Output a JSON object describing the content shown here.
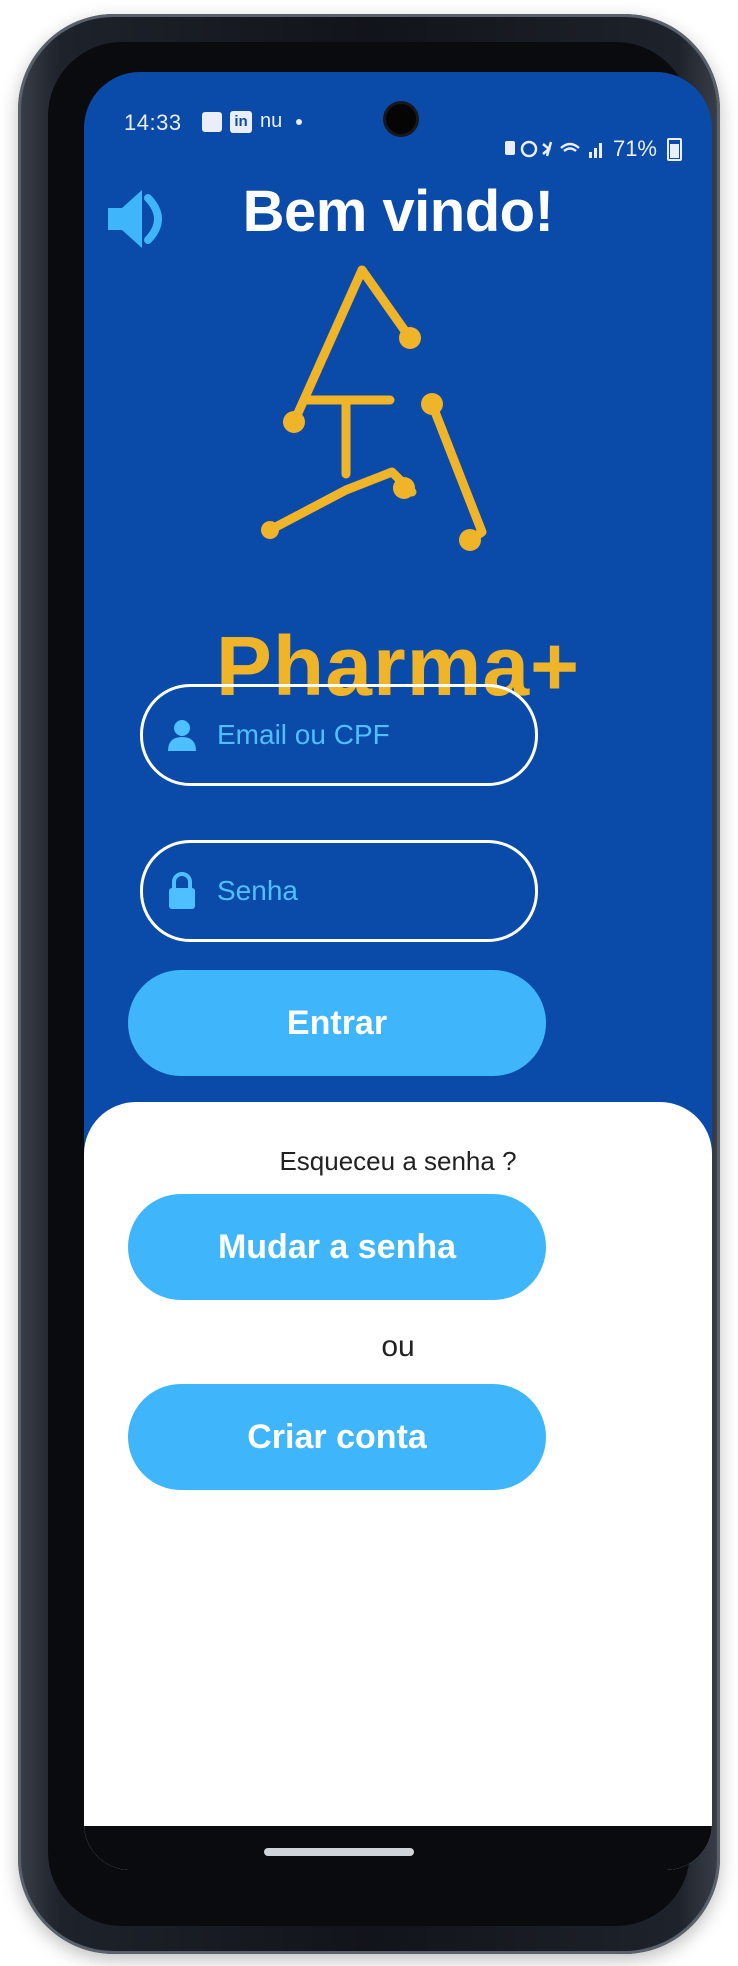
{
  "status_bar": {
    "time": "14:33",
    "app_mark": "in",
    "nu": "nu",
    "battery": "71%"
  },
  "header": {
    "title": "Bem vindo!",
    "sound_icon": "speaker-volume-icon"
  },
  "brand": {
    "name": "Pharma+",
    "color": "#f0b429"
  },
  "login": {
    "email_placeholder": "Email ou CPF",
    "password_placeholder": "Senha",
    "submit_label": "Entrar"
  },
  "recovery": {
    "forgot_text": "Esqueceu a senha ?",
    "change_password_label": "Mudar a senha",
    "separator": "ou",
    "create_account_label": "Criar conta"
  },
  "colors": {
    "background": "#0a4aa8",
    "accent": "#3fb6fb",
    "input_text": "#4ec0ff",
    "sheet": "#ffffff"
  }
}
